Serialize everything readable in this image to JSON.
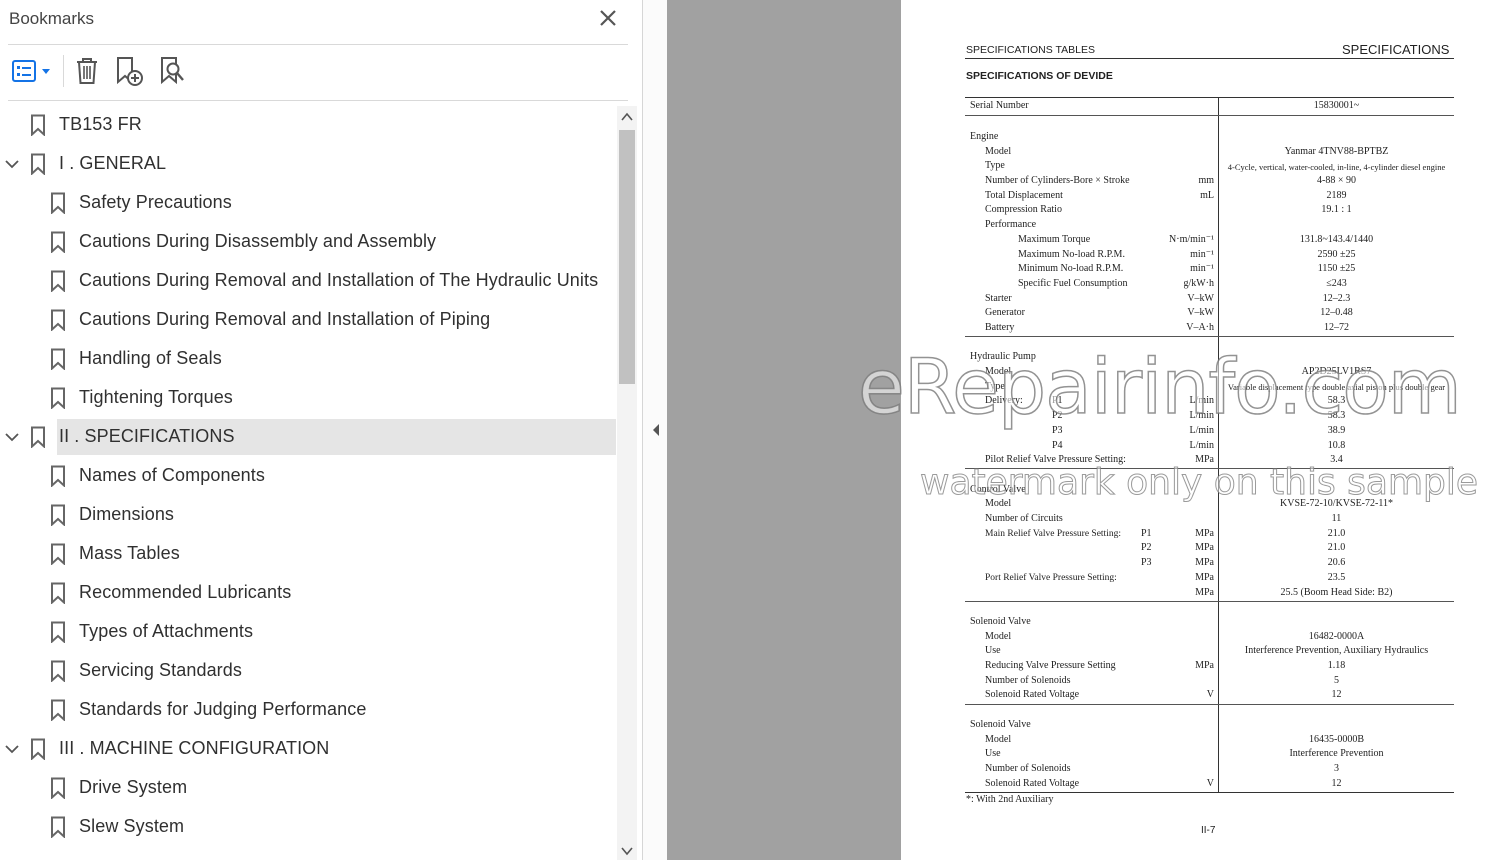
{
  "panel": {
    "title": "Bookmarks",
    "toolbar": {
      "options_icon": "list-options-icon",
      "delete_icon": "trash-icon",
      "new_icon": "bookmark-add-icon",
      "find_icon": "bookmark-search-icon"
    },
    "items": [
      {
        "label": "TB153 FR",
        "level": 0,
        "expanded": null,
        "selected": false
      },
      {
        "label": "I . GENERAL",
        "level": 0,
        "expanded": true,
        "selected": false
      },
      {
        "label": "Safety Precautions",
        "level": 1,
        "expanded": null,
        "selected": false
      },
      {
        "label": "Cautions During Disassembly and Assembly",
        "level": 1,
        "expanded": null,
        "selected": false
      },
      {
        "label": "Cautions During Removal and Installation of The Hydraulic Units",
        "level": 1,
        "expanded": null,
        "selected": false
      },
      {
        "label": "Cautions During Removal and Installation of Piping",
        "level": 1,
        "expanded": null,
        "selected": false
      },
      {
        "label": "Handling of Seals",
        "level": 1,
        "expanded": null,
        "selected": false
      },
      {
        "label": "Tightening Torques",
        "level": 1,
        "expanded": null,
        "selected": false
      },
      {
        "label": "II . SPECIFICATIONS",
        "level": 0,
        "expanded": true,
        "selected": true
      },
      {
        "label": "Names of Components",
        "level": 1,
        "expanded": null,
        "selected": false
      },
      {
        "label": "Dimensions",
        "level": 1,
        "expanded": null,
        "selected": false
      },
      {
        "label": "Mass Tables",
        "level": 1,
        "expanded": null,
        "selected": false
      },
      {
        "label": "Recommended Lubricants",
        "level": 1,
        "expanded": null,
        "selected": false
      },
      {
        "label": "Types of Attachments",
        "level": 1,
        "expanded": null,
        "selected": false
      },
      {
        "label": "Servicing Standards",
        "level": 1,
        "expanded": null,
        "selected": false
      },
      {
        "label": "Standards for Judging Performance",
        "level": 1,
        "expanded": null,
        "selected": false
      },
      {
        "label": "III . MACHINE CONFIGURATION",
        "level": 0,
        "expanded": true,
        "selected": false
      },
      {
        "label": "Drive System",
        "level": 1,
        "expanded": null,
        "selected": false
      },
      {
        "label": "Slew System",
        "level": 1,
        "expanded": null,
        "selected": false
      }
    ]
  },
  "document": {
    "header_left": "SPECIFICATIONS TABLES",
    "header_right": "SPECIFICATIONS",
    "subtitle": "SPECIFICATIONS OF DEVIDE",
    "serial_label": "Serial Number",
    "serial_value": "15830001~",
    "engine": {
      "section": "Engine",
      "model_label": "Model",
      "model_value": "Yanmar 4TNV88-BPTBZ",
      "type_label": "Type",
      "type_value": "4-Cycle, vertical, water-cooled, in-line, 4-cylinder diesel engine",
      "cyl_label": "Number of Cylinders-Bore × Stroke",
      "cyl_unit": "mm",
      "cyl_value": "4-88 × 90",
      "disp_label": "Total Displacement",
      "disp_unit": "mL",
      "disp_value": "2189",
      "comp_label": "Compression Ratio",
      "comp_value": "19.1 : 1",
      "perf_label": "Performance",
      "torque_label": "Maximum Torque",
      "torque_unit": "N·m/min⁻¹",
      "torque_value": "131.8~143.4/1440",
      "maxrpm_label": "Maximum No-load R.P.M.",
      "maxrpm_unit": "min⁻¹",
      "maxrpm_value": "2590 ±25",
      "minrpm_label": "Minimum No-load R.P.M.",
      "minrpm_unit": "min⁻¹",
      "minrpm_value": "1150 ±25",
      "fuel_label": "Specific Fuel Consumption",
      "fuel_unit": "g/kW·h",
      "fuel_value": "≤243",
      "starter_label": "Starter",
      "starter_unit": "V–kW",
      "starter_value": "12–2.3",
      "gen_label": "Generator",
      "gen_unit": "V–kW",
      "gen_value": "12–0.48",
      "bat_label": "Battery",
      "bat_unit": "V–A·h",
      "bat_value": "12–72"
    },
    "pump": {
      "section": "Hydraulic Pump",
      "model_label": "Model",
      "model_value": "AP2D25LV1RS7",
      "type_label": "Type",
      "type_value": "Variable displacement type double axial piston plus double gear",
      "delivery_label": "Delivery:",
      "p1": "P1",
      "p1_unit": "L/min",
      "p1_value": "58.3",
      "p2": "P2",
      "p2_unit": "L/min",
      "p2_value": "58.3",
      "p3": "P3",
      "p3_unit": "L/min",
      "p3_value": "38.9",
      "p4": "P4",
      "p4_unit": "L/min",
      "p4_value": "10.8",
      "pilot_label": "Pilot Relief Valve Pressure Setting:",
      "pilot_unit": "MPa",
      "pilot_value": "3.4"
    },
    "control": {
      "section": "Control Valve",
      "model_label": "Model",
      "model_value": "KVSE-72-10/KVSE-72-11*",
      "circ_label": "Number of Circuits",
      "circ_value": "11",
      "main_label": "Main Relief Valve Pressure Setting:",
      "p1": "P1",
      "p1_unit": "MPa",
      "p1_value": "21.0",
      "p2": "P2",
      "p2_unit": "MPa",
      "p2_value": "21.0",
      "p3": "P3",
      "p3_unit": "MPa",
      "p3_value": "20.6",
      "port_label": "Port Relief Valve Pressure Setting:",
      "port_unit": "MPa",
      "port_value": "23.5",
      "port2_unit": "MPa",
      "port2_value": "25.5 (Boom Head Side: B2)"
    },
    "solenoid1": {
      "section": "Solenoid Valve",
      "model_label": "Model",
      "model_value": "16482-0000A",
      "use_label": "Use",
      "use_value": "Interference Prevention, Auxiliary Hydraulics",
      "red_label": "Reducing Valve Pressure Setting",
      "red_unit": "MPa",
      "red_value": "1.18",
      "num_label": "Number of Solenoids",
      "num_value": "5",
      "volt_label": "Solenoid Rated Voltage",
      "volt_unit": "V",
      "volt_value": "12"
    },
    "solenoid2": {
      "section": "Solenoid Valve",
      "model_label": "Model",
      "model_value": "16435-0000B",
      "use_label": "Use",
      "use_value": "Interference Prevention",
      "num_label": "Number of Solenoids",
      "num_value": "3",
      "volt_label": "Solenoid Rated Voltage",
      "volt_unit": "V",
      "volt_value": "12"
    },
    "footnote": "*: With 2nd Auxiliary",
    "page_number": "II-7",
    "watermark_main": "eRepairinfo.com",
    "watermark_sub": "watermark only on this sample"
  }
}
